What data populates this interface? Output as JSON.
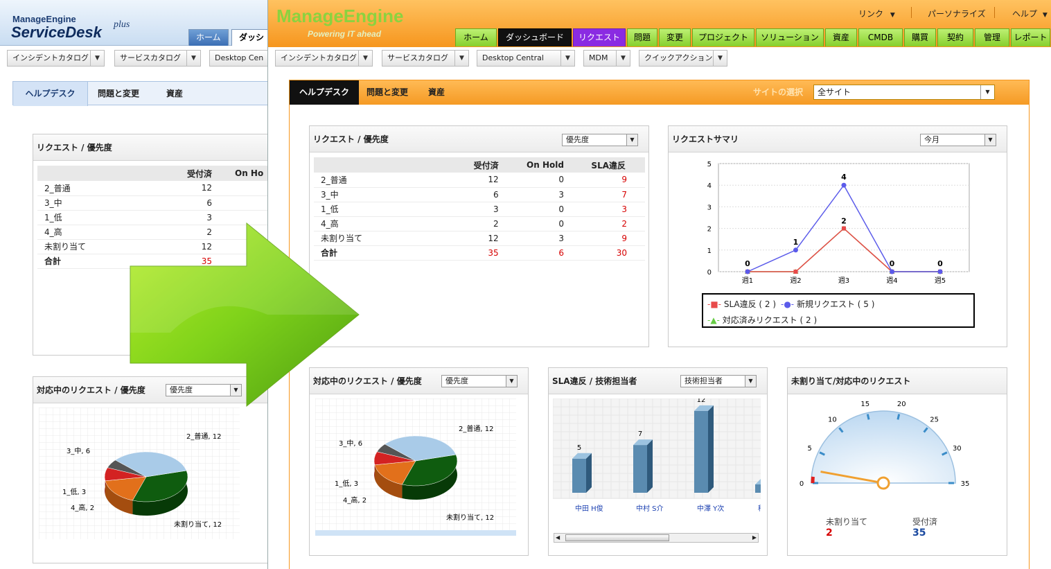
{
  "old_ui": {
    "logo_top": "ManageEngine",
    "logo_main": "ServiceDesk",
    "logo_plus": "plus",
    "tabs": [
      "ホーム",
      "ダッシュ"
    ],
    "toolbar": [
      "インシデントカタログ",
      "サービスカタログ",
      "Desktop Cen"
    ],
    "subtabs": [
      "ヘルプデスク",
      "問題と変更",
      "資産"
    ],
    "panel1": {
      "title": "リクエスト / 優先度",
      "columns": [
        "",
        "受付済",
        "On Ho"
      ],
      "rows": [
        {
          "name": "2_普通",
          "v": "12"
        },
        {
          "name": "3_中",
          "v": "6"
        },
        {
          "name": "1_低",
          "v": "3"
        },
        {
          "name": "4_高",
          "v": "2"
        },
        {
          "name": "未割り当て",
          "v": "12"
        },
        {
          "name": "合計",
          "v": "35"
        }
      ]
    },
    "panel2": {
      "title": "対応中のリクエスト / 優先度",
      "select": "優先度",
      "pie_labels": [
        "2_普通, 12",
        "3_中, 6",
        "1_低, 3",
        "4_高, 2",
        "未割り当て, 12"
      ]
    }
  },
  "new_ui": {
    "logo": "ManageEngine",
    "tagline": "Powering IT ahead",
    "top_links": [
      "リンク",
      "パーソナライズ",
      "ヘルプ"
    ],
    "nav": [
      "ホーム",
      "ダッシュボード",
      "リクエスト",
      "問題",
      "変更",
      "プロジェクト",
      "ソリューション",
      "資産",
      "CMDB",
      "購買",
      "契約",
      "管理",
      "レポート"
    ],
    "toolbar": [
      "インシデントカタログ",
      "サービスカタログ",
      "Desktop Central",
      "MDM",
      "クイックアクション"
    ],
    "subtabs": [
      "ヘルプデスク",
      "問題と変更",
      "資産"
    ],
    "site_label": "サイトの選択",
    "site_value": "全サイト",
    "req_priority": {
      "title": "リクエスト / 優先度",
      "select": "優先度",
      "columns": [
        "",
        "受付済",
        "On Hold",
        "SLA違反"
      ],
      "rows": [
        {
          "name": "2_普通",
          "a": "12",
          "b": "0",
          "c": "9"
        },
        {
          "name": "3_中",
          "a": "6",
          "b": "3",
          "c": "7"
        },
        {
          "name": "1_低",
          "a": "3",
          "b": "0",
          "c": "3"
        },
        {
          "name": "4_高",
          "a": "2",
          "b": "0",
          "c": "2"
        },
        {
          "name": "未割り当て",
          "a": "12",
          "b": "3",
          "c": "9"
        },
        {
          "name": "合計",
          "a": "35",
          "b": "6",
          "c": "30"
        }
      ]
    },
    "req_summary": {
      "title": "リクエストサマリ",
      "select": "今月",
      "legend": [
        "SLA違反 ( 2 )",
        "新規リクエスト ( 5 )",
        "対応済みリクエスト ( 2 )"
      ]
    },
    "open_priority": {
      "title": "対応中のリクエスト / 優先度",
      "select": "優先度",
      "pie_labels": [
        "2_普通, 12",
        "3_中, 6",
        "1_低, 3",
        "4_高, 2",
        "未割り当て, 12"
      ]
    },
    "sla_tech": {
      "title": "SLA違反 / 技術担当者",
      "select": "技術担当者",
      "techs": [
        "中田 H俊",
        "中村 S介",
        "中澤 Y次",
        "稲本 J"
      ],
      "values": [
        "5",
        "7",
        "12"
      ]
    },
    "gauge": {
      "title": "未割り当て/対応中のリクエスト",
      "ticks": [
        "0",
        "5",
        "10",
        "15",
        "20",
        "25",
        "30",
        "35"
      ],
      "unassigned_label": "未割り当て",
      "unassigned_value": "2",
      "accepted_label": "受付済",
      "accepted_value": "35"
    }
  },
  "chart_data": [
    {
      "type": "line",
      "categories": [
        "週1",
        "週2",
        "週3",
        "週4",
        "週5"
      ],
      "ylim": [
        0,
        5
      ],
      "series": [
        {
          "name": "SLA違反 ( 2 )",
          "values": [
            0,
            0,
            2,
            0,
            0
          ],
          "color": "#e84a4a"
        },
        {
          "name": "新規リクエスト ( 5 )",
          "values": [
            0,
            1,
            4,
            0,
            0
          ],
          "color": "#5b5bea"
        },
        {
          "name": "対応済みリクエスト ( 2 )",
          "values": [
            0,
            0,
            2,
            0,
            0
          ],
          "color": "#66cc44"
        }
      ],
      "grid": true,
      "legend": "bottom"
    },
    {
      "type": "pie",
      "categories": [
        "2_普通",
        "3_中",
        "1_低",
        "4_高",
        "未割り当て"
      ],
      "values": [
        12,
        6,
        3,
        2,
        12
      ]
    },
    {
      "type": "bar",
      "categories": [
        "中田 H俊",
        "中村 S介",
        "中澤 Y次",
        "稲本 J"
      ],
      "values": [
        5,
        7,
        12,
        null
      ]
    },
    {
      "type": "gauge",
      "range": [
        0,
        35
      ],
      "value": 2
    }
  ],
  "colors": {
    "header_orange": "#f6961e",
    "nav_green": "#86cf2c",
    "request_tab": "#8a2be2",
    "sla_red": "#d60000",
    "accepted_blue": "#1b4aa0"
  }
}
